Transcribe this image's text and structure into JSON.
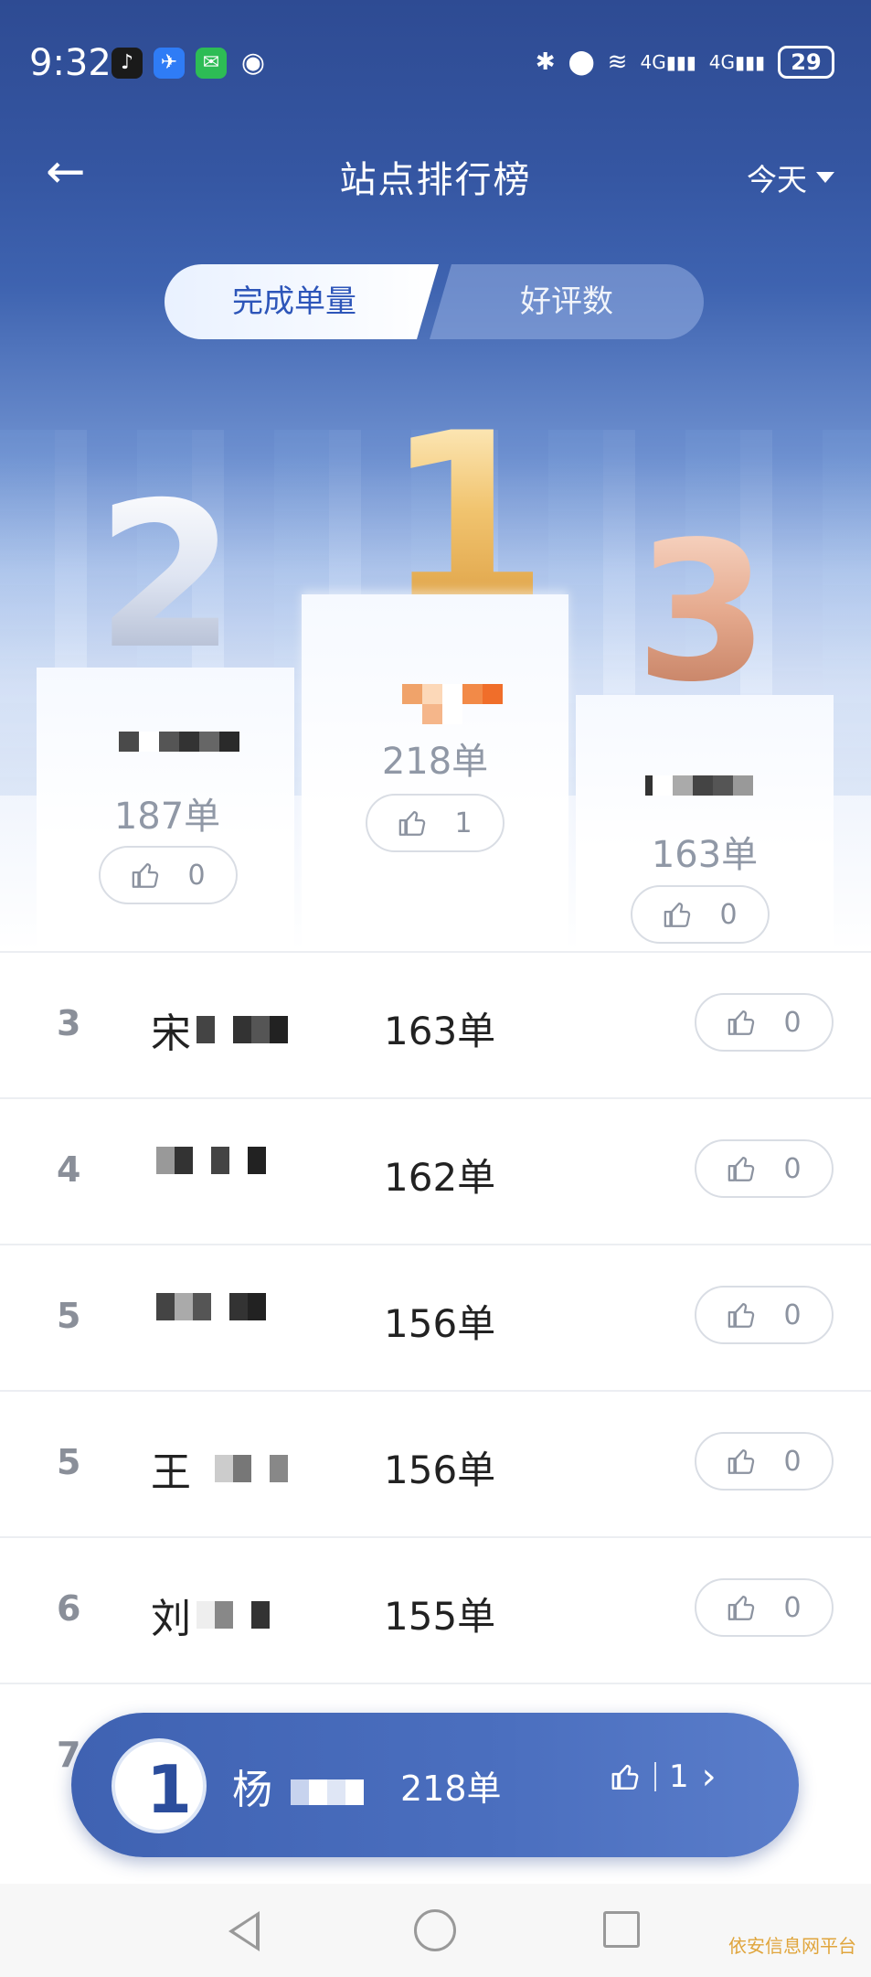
{
  "status_bar": {
    "time": "9:32",
    "battery": "29",
    "network": "4G",
    "network2": "4G",
    "wifi_sub": "6"
  },
  "header": {
    "title": "站点排行榜",
    "period": "今天"
  },
  "tabs": [
    {
      "label": "完成单量",
      "active": true
    },
    {
      "label": "好评数",
      "active": false
    }
  ],
  "podium": {
    "first": {
      "rank": "1",
      "count": "218单",
      "likes": "1"
    },
    "second": {
      "rank": "2",
      "count": "187单",
      "likes": "0"
    },
    "third": {
      "rank": "3",
      "count": "163单",
      "likes": "0"
    }
  },
  "list": [
    {
      "rank": "3",
      "name_prefix": "宋",
      "count": "163单",
      "likes": "0"
    },
    {
      "rank": "4",
      "name_prefix": "",
      "count": "162单",
      "likes": "0"
    },
    {
      "rank": "5",
      "name_prefix": "",
      "count": "156单",
      "likes": "0"
    },
    {
      "rank": "5",
      "name_prefix": "王",
      "count": "156单",
      "likes": "0"
    },
    {
      "rank": "6",
      "name_prefix": "刘",
      "count": "155单",
      "likes": "0"
    }
  ],
  "my_rank": {
    "rank": "1",
    "name_prefix": "杨",
    "count": "218单",
    "likes": "1"
  },
  "watermark": "依安信息网平台",
  "colors": {
    "primary": "#3556a2",
    "gold": "#e6b45a",
    "silver": "#c9d1e2",
    "bronze": "#d99a7e"
  }
}
